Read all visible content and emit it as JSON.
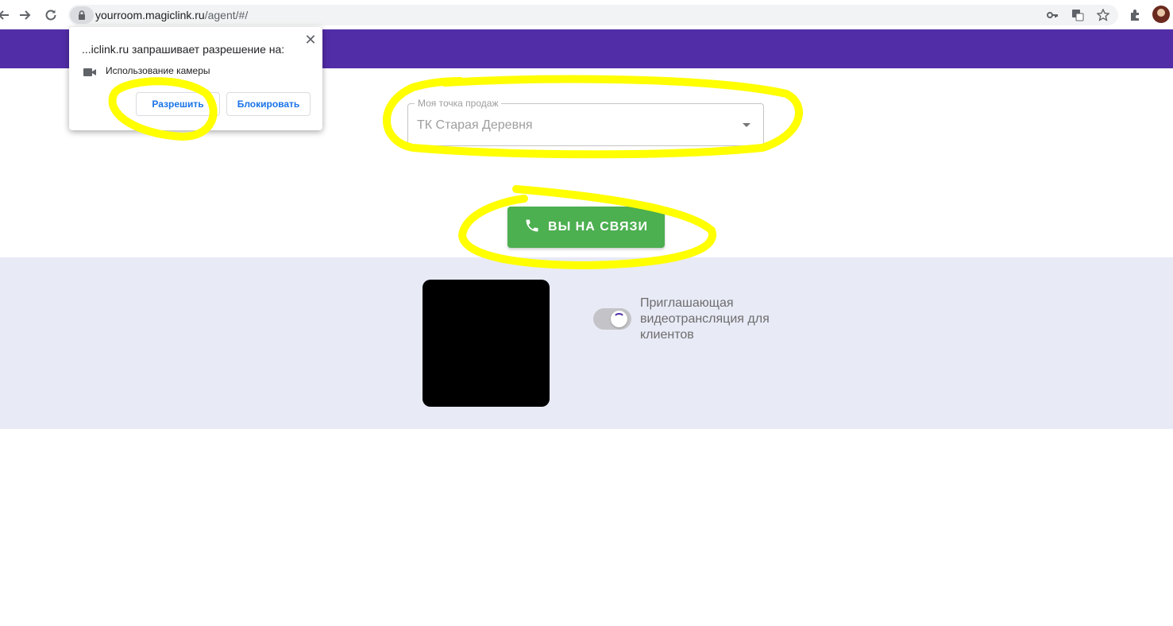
{
  "browser": {
    "url_host": "yourroom.magiclink.ru",
    "url_path": "/agent/#/",
    "icons": [
      "back-arrow-icon",
      "forward-arrow-icon",
      "reload-icon",
      "lock-icon",
      "key-icon",
      "translate-icon",
      "star-icon",
      "extensions-icon",
      "profile-avatar"
    ]
  },
  "permission_popup": {
    "title": "...iclink.ru запрашивает разрешение на:",
    "item_icon": "camera-icon",
    "item_label": "Использование камеры",
    "allow_label": "Разрешить",
    "block_label": "Блокировать",
    "close_label": "✕"
  },
  "header": {
    "color": "#512da8"
  },
  "point_of_sale": {
    "label": "Моя точка продаж",
    "value": "ТК Старая Деревня"
  },
  "call_button": {
    "icon": "phone-icon",
    "label": "ВЫ НА СВЯЗИ",
    "color": "#4caf50"
  },
  "video_panel": {
    "background": "#e8eaf6",
    "toggle_label": "Приглашающая видеотрансляция для клиентов",
    "toggle_state": "loading"
  },
  "annotations": {
    "highlight_color": "#ffff00"
  }
}
